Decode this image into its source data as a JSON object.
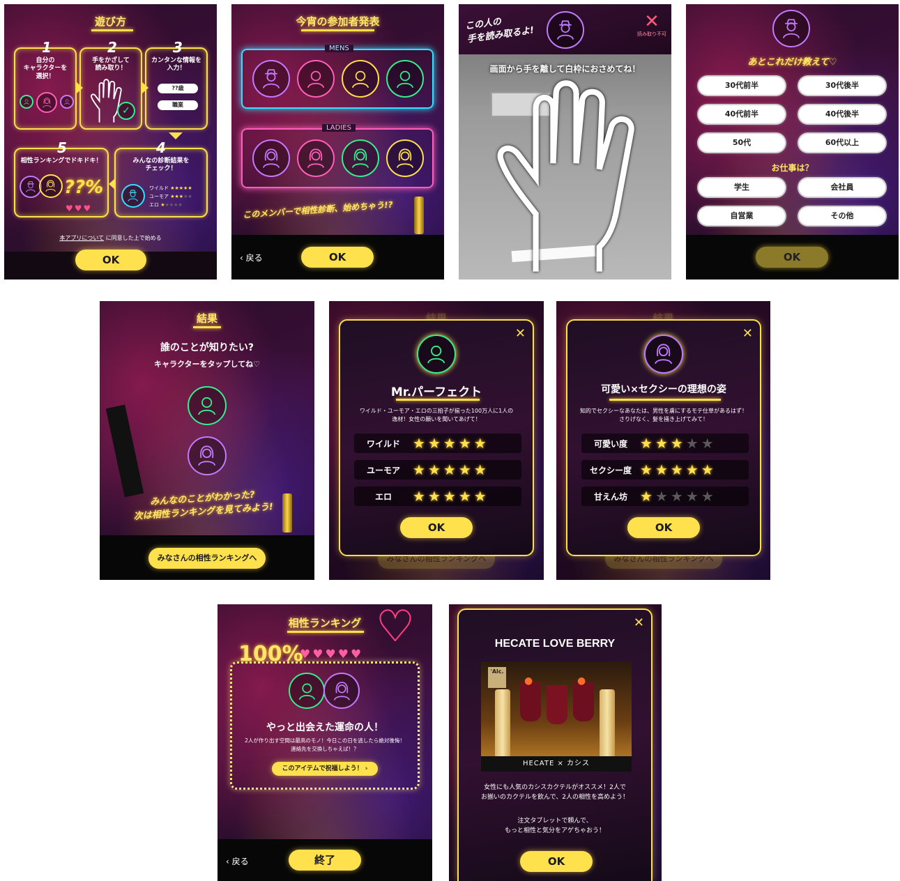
{
  "colors": {
    "accent": "#ffe14d",
    "cyan": "#33e0ff",
    "pink": "#ff5fb8",
    "green": "#35f08a",
    "purple": "#c07bff"
  },
  "s1": {
    "title": "遊び方",
    "step1_num": "1",
    "step1_text": "自分の\nキャラクターを\n選択！",
    "step2_num": "2",
    "step2_text": "手をかざして\n読み取り！",
    "step3_num": "3",
    "step3_text": "カンタンな情報を\n入力！",
    "step3_chip1": "??歳",
    "step3_chip2": "職業",
    "step4_num": "4",
    "step4_text": "みんなの診断結果を\nチェック！",
    "step4_rows": [
      "ワイルド",
      "ユーモア",
      "エロ"
    ],
    "step5_num": "5",
    "step5_text": "相性ランキングでドキドキ！",
    "step5_percent": "??%",
    "agree_link": "本アプリについて",
    "agree_text": "に同意した上で始める",
    "ok": "OK"
  },
  "s2": {
    "title": "今宵の参加者発表",
    "mens_label": "MENS",
    "ladies_label": "LADIES",
    "caption": "このメンバーで相性診断、始めちゃう!?",
    "back": "戻る",
    "ok": "OK"
  },
  "s3": {
    "header": "この人の\n手を読み取るよ!",
    "unreadable": "読み取り不可",
    "instruction": "画面から手を離して白枠におさめてね！"
  },
  "s4": {
    "header": "あとこれだけ教えて♡",
    "ages": [
      "30代前半",
      "30代後半",
      "40代前半",
      "40代後半",
      "50代",
      "60代以上"
    ],
    "job_question": "お仕事は？",
    "jobs": [
      "学生",
      "会社員",
      "自営業",
      "その他"
    ],
    "ok": "OK"
  },
  "s5": {
    "title": "結果",
    "q": "誰のことが知りたい?",
    "sub": "キャラクターをタップしてね♡",
    "caption": "みんなのことがわかった?\n次は相性ランキングを見てみよう!",
    "ranking_button": "みなさんの相性ランキングへ"
  },
  "s6": {
    "name": "Mr.パーフェクト",
    "desc": "ワイルド・ユーモア・エロの三拍子が揃った100万人に1人の\n逸材！女性の願いを聞いてあげて！",
    "stats": [
      {
        "label": "ワイルド",
        "score": 5
      },
      {
        "label": "ユーモア",
        "score": 5
      },
      {
        "label": "エロ",
        "score": 5
      }
    ],
    "ok": "OK",
    "behind_title": "結果",
    "behind_button": "みなさんの相性ランキングへ"
  },
  "s7": {
    "name": "可愛い×セクシーの理想の姿",
    "desc": "知的でセクシーなあなたは、男性を虜にするモテ仕草があるはず！\nさりげなく、髪を掻き上げてみて！",
    "stats": [
      {
        "label": "可愛い度",
        "score": 3
      },
      {
        "label": "セクシー度",
        "score": 5
      },
      {
        "label": "甘えん坊",
        "score": 1
      }
    ],
    "ok": "OK",
    "behind_title": "結果",
    "behind_button": "みなさんの相性ランキングへ"
  },
  "s8": {
    "title": "相性ランキング",
    "percent": "100%",
    "headline": "やっと出会えた運命の人！",
    "desc": "2人が作り出す空間は最高のモノ！今日この日を逃したら絶対後悔！\n連絡先を交換しちゃえば！？",
    "cta": "このアイテムで祝福しよう！",
    "back": "戻る",
    "end": "終了"
  },
  "s9": {
    "title": "HECATE LOVE BERRY",
    "brand_badge": "'Alc.",
    "brand_line": "HECATE × カシス",
    "desc": "女性にも人気のカシスカクテルがオススメ！2人で\nお揃いのカクテルを飲んで、2人の相性を高めよう！",
    "desc2": "注文タブレットで頼んで、\nもっと相性と気分をアゲちゃおう！",
    "ok": "OK"
  }
}
